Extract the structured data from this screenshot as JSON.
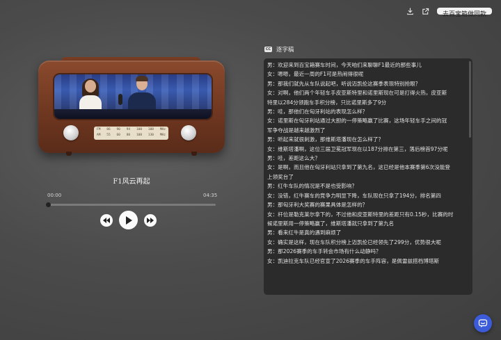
{
  "header": {
    "download_icon": "download-icon",
    "share_icon": "share-icon",
    "cta_label": "去百宝箱做同款"
  },
  "player": {
    "title": "F1风云再起",
    "time_current": "00:00",
    "time_total": "04:35",
    "progress": 0,
    "radio_bands": {
      "fm": [
        "FM",
        "86",
        "90",
        "94",
        "100",
        "108",
        "MHz"
      ],
      "am": [
        "AM",
        "55",
        "60",
        "80",
        "100",
        "130",
        "MHz"
      ]
    },
    "icons": {
      "rewind": "rewind-icon",
      "play": "play-icon",
      "forward": "fast-forward-icon"
    }
  },
  "transcript": {
    "badge": "CC",
    "title": "逐字稿",
    "lines": [
      "男：欢迎来到百宝箱赛车时间，今天咱们来聊聊F1最近的那些事儿",
      "女：嗯嗯，最近一周的F1可是热闹得很呢",
      "男：那我们就先从车队说起吧，听说迈凯伦这赛季表现特别抢眼？",
      "女：对啊，他们两个年轻车手皮亚斯特里和诺里斯现在可是打得火热，皮亚斯",
      "特里以284分领跑车手积分榜，只比诺里斯多了9分",
      "男：哇，那他们在匈牙利站的表现怎么样？",
      "女：诺里斯在匈牙利站通过大胆的一停策略赢了比赛，这场年轻车手之间的冠",
      "军争夺战是越来越激烈了",
      "男：听起来就很刺激，那维斯塔潘现在怎么样了？",
      "女：维斯塔潘啊，这位三届卫冕冠军现在以187分排在第三，落后榜首97分呢",
      "男：哇，差距这么大？",
      "女：是啊，而且他在匈牙利站只拿到了第九名，这已经是他本赛季第6次没能登",
      "上领奖台了",
      "男：红牛车队的情况是不是也受影响？",
      "女：没错，红牛赛车的竞争力明显下降，车队现在只拿了194分，排名第四",
      "男：那匈牙利大奖赛的赛果具体是怎样的？",
      "女：杆位是勒克莱尔拿下的，不过他和皮亚斯特里的差距只有0.15秒，比赛的时",
      "候诺里斯用一停策略赢了，维斯塔潘就只拿到了第九名",
      "男：看来红牛是真的遇到麻烦了",
      "女：确实是这样，现在车队积分榜上迈凯伦已经领先了299分，优势很大呢",
      "男：那2026赛季的车手转会市场有什么动静吗？",
      "女：凯迪拉克车队已经官宣了2026赛季的车手阵容，是佩雷兹搭档博塔斯"
    ]
  },
  "floating": {
    "assistant_icon": "chat-assistant-icon"
  },
  "colors": {
    "accent": "#3b5bd9",
    "radio_wood": "#6d3620",
    "panel": "#2b2b2b"
  }
}
